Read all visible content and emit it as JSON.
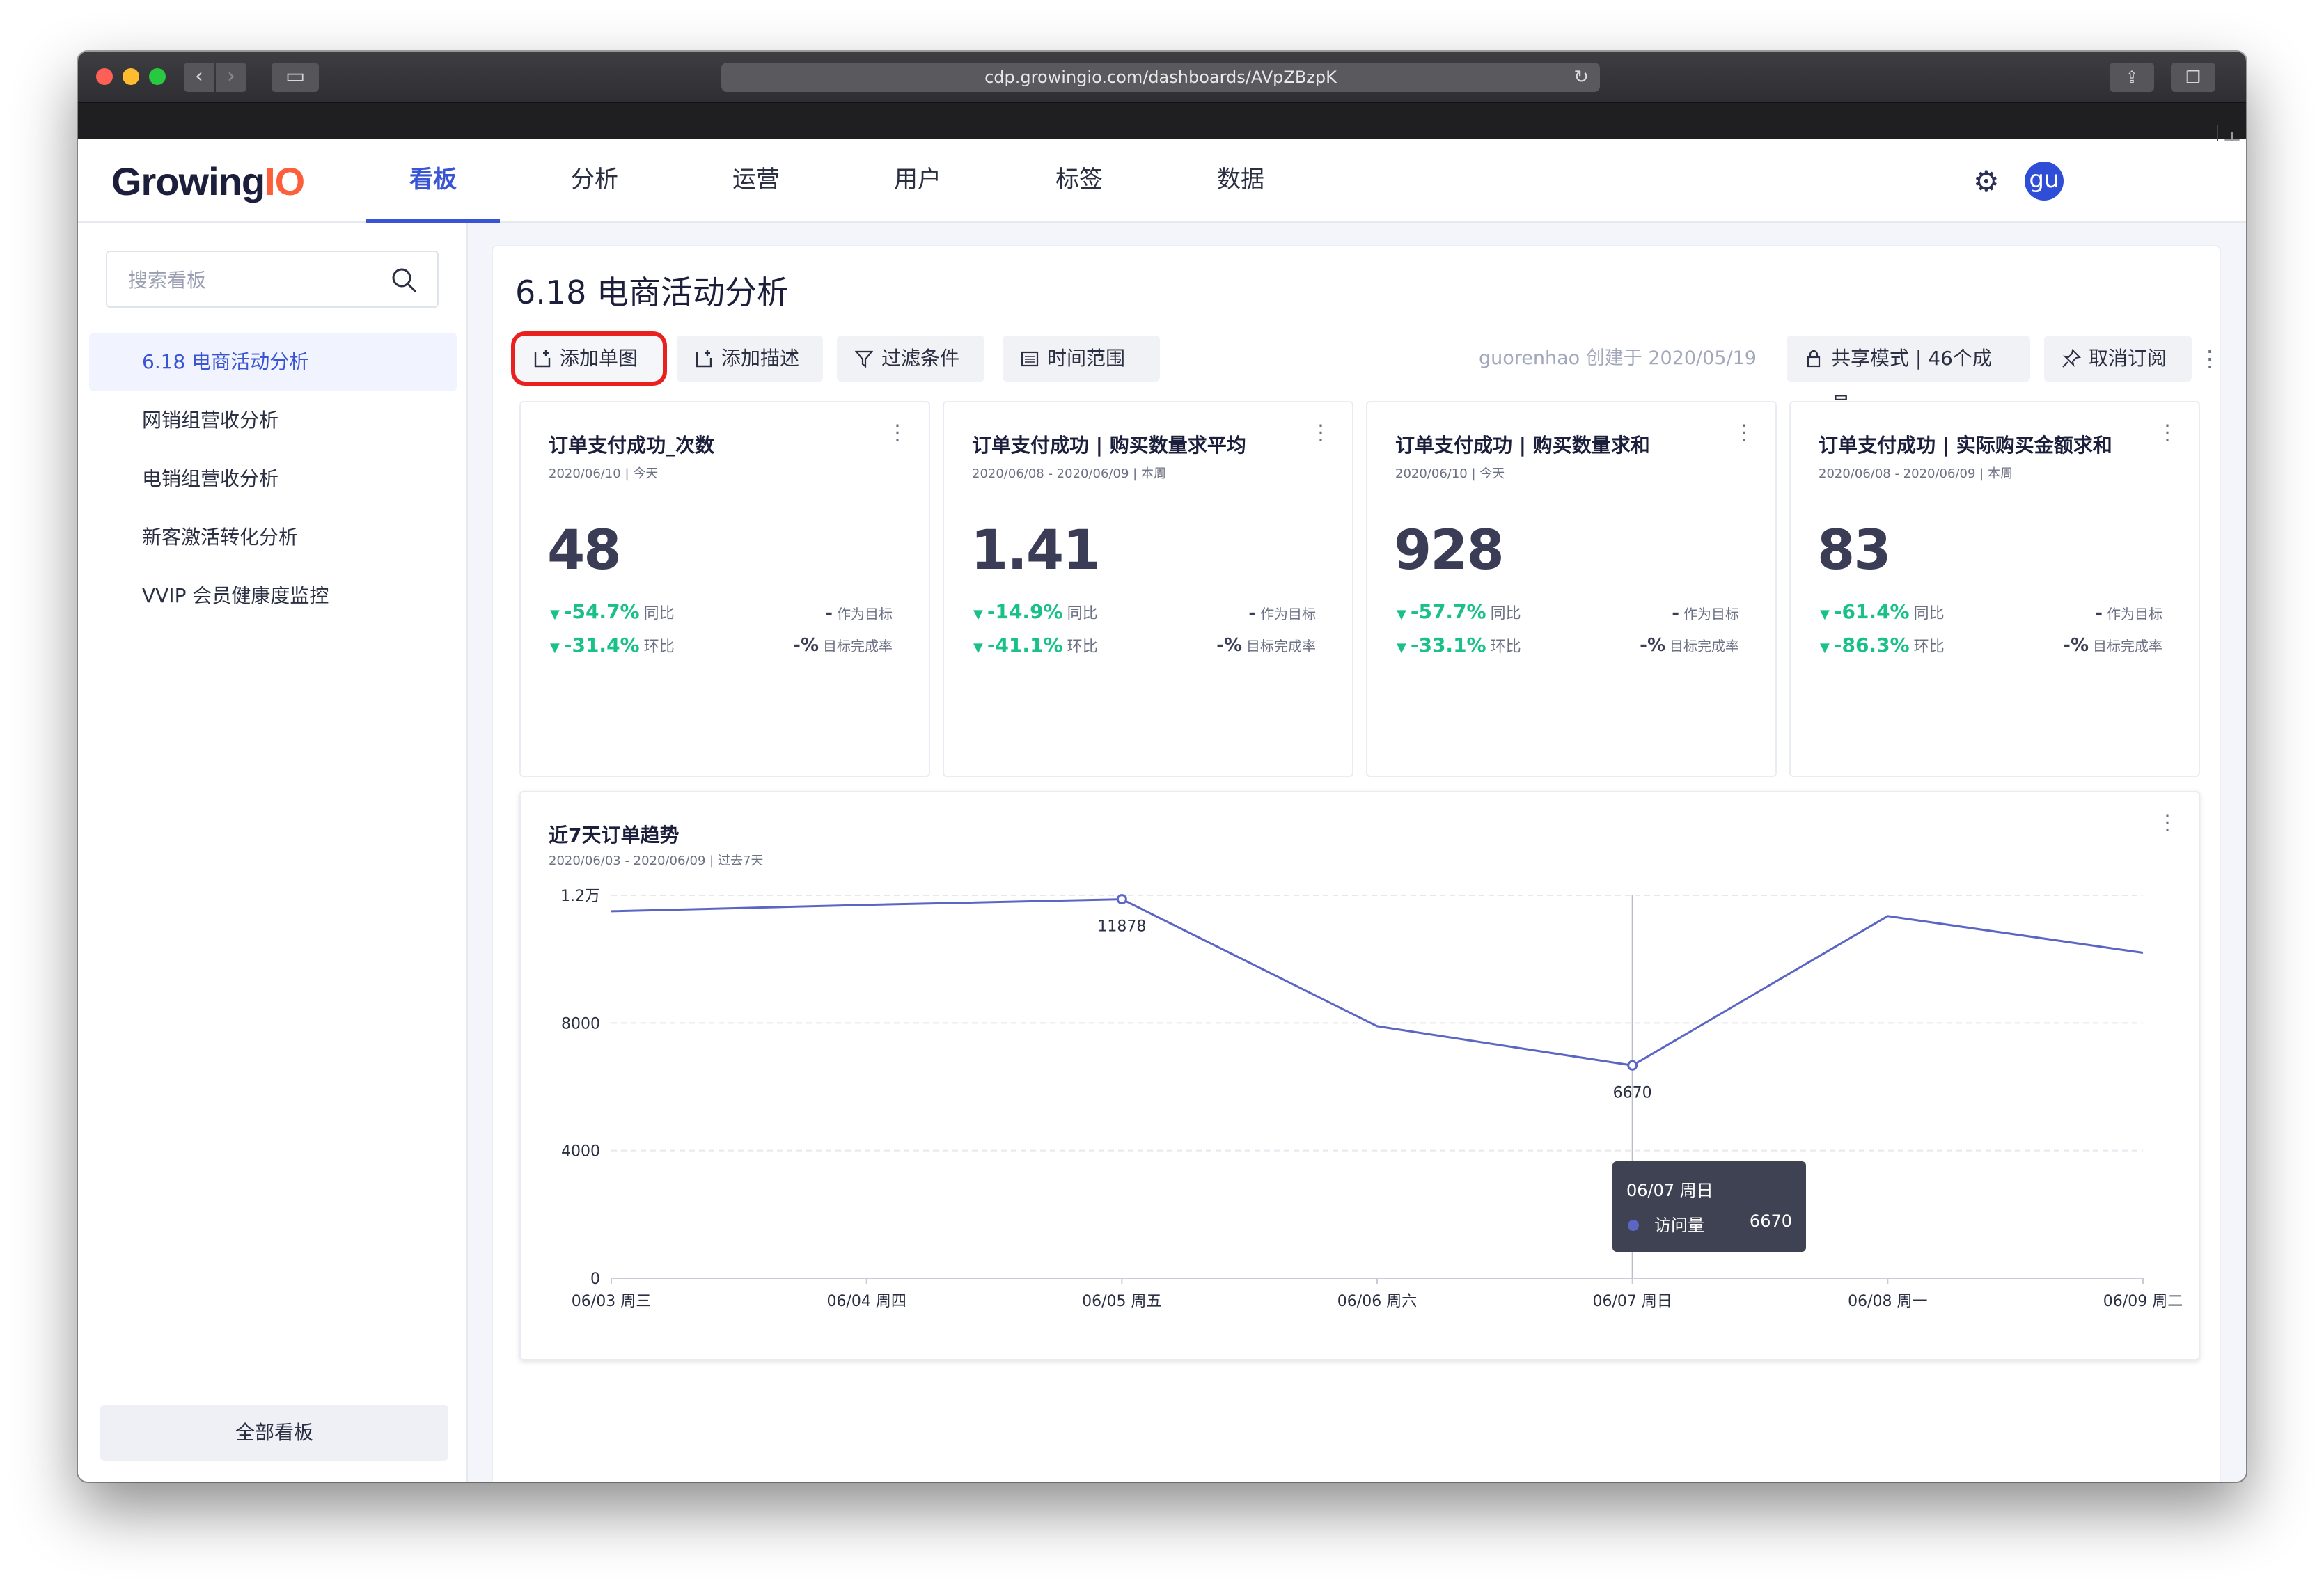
{
  "browser": {
    "url": "cdp.growingio.com/dashboards/AVpZBzpK"
  },
  "app": {
    "logo_main": "Growing",
    "logo_accent": "IO",
    "nav_tabs": [
      "看板",
      "分析",
      "运营",
      "用户",
      "标签",
      "数据"
    ],
    "active_tab": "看板",
    "avatar": "gu"
  },
  "sidebar": {
    "search_placeholder": "搜索看板",
    "items": [
      "6.18 电商活动分析",
      "网销组营收分析",
      "电销组营收分析",
      "新客激活转化分析",
      "VVIP 会员健康度监控"
    ],
    "active_item": "6.18 电商活动分析",
    "all_boards": "全部看板"
  },
  "dashboard": {
    "title": "6.18 电商活动分析",
    "toolbar": {
      "add_chart": "添加单图",
      "add_desc": "添加描述",
      "filter": "过滤条件",
      "time_range": "时间范围",
      "creator": "guorenhao 创建于 2020/05/19",
      "share_mode": "共享模式 | 46个成员",
      "unsubscribe": "取消订阅"
    },
    "cards": [
      {
        "title": "订单支付成功_次数",
        "sub": "2020/06/10 | 今天",
        "value": "48",
        "yoy": "-54.7%",
        "yoy_label": "同比",
        "mom": "-31.4%",
        "mom_label": "环比",
        "target_val": "-",
        "target_label": "作为目标",
        "completion_val": "-%",
        "completion_label": "目标完成率"
      },
      {
        "title": "订单支付成功 | 购买数量求平均",
        "sub": "2020/06/08 - 2020/06/09 | 本周",
        "value": "1.41",
        "yoy": "-14.9%",
        "yoy_label": "同比",
        "mom": "-41.1%",
        "mom_label": "环比",
        "target_val": "-",
        "target_label": "作为目标",
        "completion_val": "-%",
        "completion_label": "目标完成率"
      },
      {
        "title": "订单支付成功 | 购买数量求和",
        "sub": "2020/06/10 | 今天",
        "value": "928",
        "yoy": "-57.7%",
        "yoy_label": "同比",
        "mom": "-33.1%",
        "mom_label": "环比",
        "target_val": "-",
        "target_label": "作为目标",
        "completion_val": "-%",
        "completion_label": "目标完成率"
      },
      {
        "title": "订单支付成功 | 实际购买金额求和",
        "sub": "2020/06/08 - 2020/06/09 | 本周",
        "value": "83",
        "yoy": "-61.4%",
        "yoy_label": "同比",
        "mom": "-86.3%",
        "mom_label": "环比",
        "target_val": "-",
        "target_label": "作为目标",
        "completion_val": "-%",
        "completion_label": "目标完成率"
      }
    ],
    "trend": {
      "title": "近7天订单趋势",
      "sub": "2020/06/03 - 2020/06/09 | 过去7天",
      "tooltip": {
        "date": "06/07 周日",
        "label": "访问量",
        "value": "6670"
      }
    }
  },
  "colors": {
    "accent": "#3a55d4",
    "line": "#5b66c4",
    "positive_change": "#19c08a",
    "highlight_border": "#e8211f"
  },
  "chart_data": {
    "type": "line",
    "categories": [
      "06/03 周三",
      "06/04 周四",
      "06/05 周五",
      "06/06 周六",
      "06/07 周日",
      "06/08 周一",
      "06/09 周二"
    ],
    "series": [
      {
        "name": "访问量",
        "values": [
          11500,
          11700,
          11878,
          7900,
          6670,
          11350,
          10200
        ]
      }
    ],
    "ytick_labels": [
      "0",
      "4000",
      "8000",
      "1.2万"
    ],
    "yticks": [
      0,
      4000,
      8000,
      12000
    ],
    "ylim": [
      0,
      12000
    ],
    "point_labels": [
      {
        "index": 2,
        "text": "11878"
      },
      {
        "index": 4,
        "text": "6670"
      }
    ],
    "hover_index": 4,
    "grid": true
  }
}
